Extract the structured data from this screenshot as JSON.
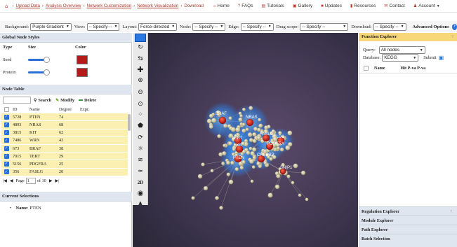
{
  "nav": {
    "breadcrumbs": [
      "Upload Data",
      "Analysis Overview",
      "Network Customization",
      "Network Visualization",
      "Download"
    ],
    "menu": [
      "Home",
      "FAQs",
      "Tutorials",
      "Gallery",
      "Updates",
      "Resources",
      "Contact",
      "Account"
    ]
  },
  "options": {
    "background_label": "Background:",
    "background_value": "Purple Gradient",
    "view_label": "View:",
    "view_value": "-- Specify --",
    "layout_label": "Layout:",
    "layout_value": "Force-directed",
    "node_label": "Node:",
    "node_value": "-- Specify --",
    "edge_label": "Edge:",
    "edge_value": "-- Specify --",
    "drag_label": "Drag scope:",
    "drag_value": "-- Specify --",
    "download_label": "Download:",
    "download_value": "-- Specify --",
    "advanced": "Advanced Options",
    "help": "?"
  },
  "node_styles": {
    "title": "Global Node Styles",
    "col_type": "Type",
    "col_size": "Size",
    "col_color": "Color",
    "rows": [
      {
        "type": "Seed",
        "size_level": 0.75,
        "color": "#b41a1a"
      },
      {
        "type": "Protein",
        "size_level": 0.75,
        "color": "#b41a1a"
      }
    ]
  },
  "node_table": {
    "title": "Node Table",
    "search": "Search",
    "modify": "Modify",
    "delete": "Delete",
    "headers": [
      "ID",
      "Name",
      "Degree",
      "Expr."
    ],
    "rows": [
      {
        "id": "5728",
        "name": "PTEN",
        "degree": "74",
        "expr": ""
      },
      {
        "id": "4893",
        "name": "NRAS",
        "degree": "68",
        "expr": ""
      },
      {
        "id": "3815",
        "name": "KIT",
        "degree": "62",
        "expr": ""
      },
      {
        "id": "7486",
        "name": "WRN",
        "degree": "42",
        "expr": ""
      },
      {
        "id": "673",
        "name": "BRAF",
        "degree": "38",
        "expr": ""
      },
      {
        "id": "7015",
        "name": "TERT",
        "degree": "29",
        "expr": ""
      },
      {
        "id": "5156",
        "name": "PDGFRA",
        "degree": "25",
        "expr": ""
      },
      {
        "id": "356",
        "name": "FASLG",
        "degree": "20",
        "expr": ""
      }
    ],
    "pager": {
      "page_label": "Page",
      "page": "1",
      "of_label": "of 10"
    }
  },
  "current_selections": {
    "title": "Current Selections",
    "item_label": "Name",
    "item_value": "PTEN"
  },
  "network": {
    "labels": [
      "BRAF",
      "NRAS",
      "TERT",
      "KIT",
      "PTEN",
      "FASLG",
      "PDGFRA",
      "TLD1",
      "CREBBP",
      "SNIP1"
    ]
  },
  "function_explorer": {
    "title": "Function Explorer",
    "help": "?",
    "query_label": "Query:",
    "query_value": "All nodes",
    "database_label": "Database:",
    "database_value": "KEGG",
    "submit": "Submit",
    "col_name": "Name",
    "col_hit": "Hit P-va P-va"
  },
  "explorers": [
    {
      "title": "Regulation Explorer",
      "help": "?"
    },
    {
      "title": "Module Explorer",
      "help": ""
    },
    {
      "title": "Path Explorer",
      "help": ""
    },
    {
      "title": "Batch Selection",
      "help": ""
    }
  ]
}
